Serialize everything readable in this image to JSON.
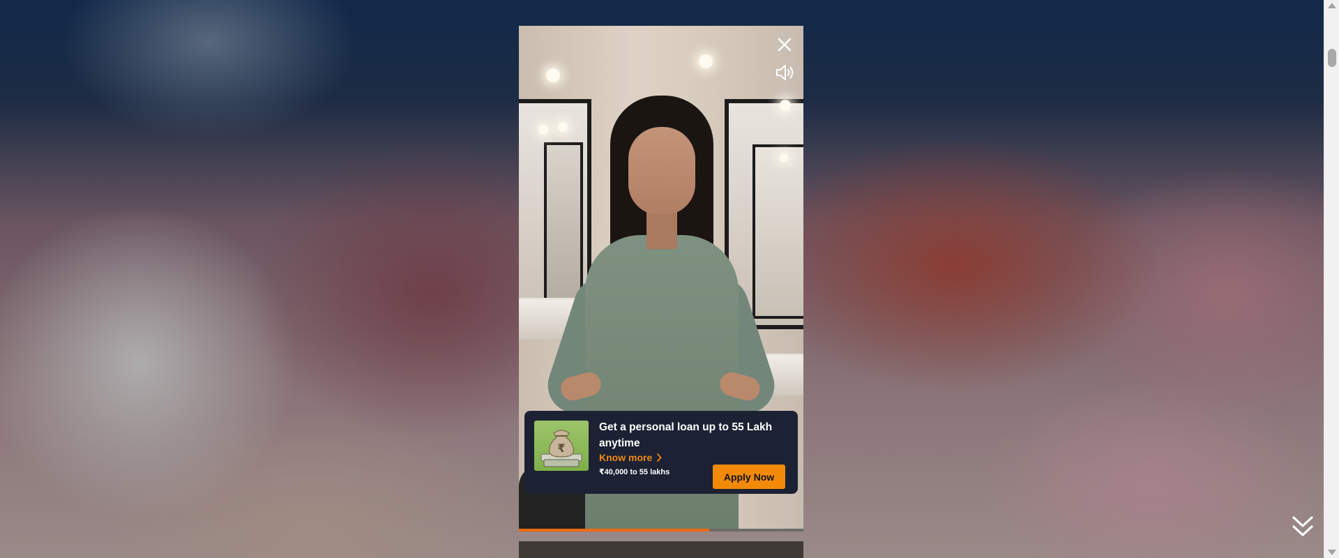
{
  "player": {
    "close_icon": "close-icon",
    "mute_icon": "speaker-icon",
    "progress": 0.67
  },
  "ad": {
    "thumb_icon": "money-bag-icon",
    "title": "Get a personal loan up to 55 Lakh anytime",
    "link_label": "Know more",
    "range": "₹40,000 to 55 lakhs",
    "cta": "Apply Now",
    "accent": "#f28a08",
    "card_bg": "#1c2233"
  },
  "navigation": {
    "next_icon": "double-chevron-down-icon"
  }
}
